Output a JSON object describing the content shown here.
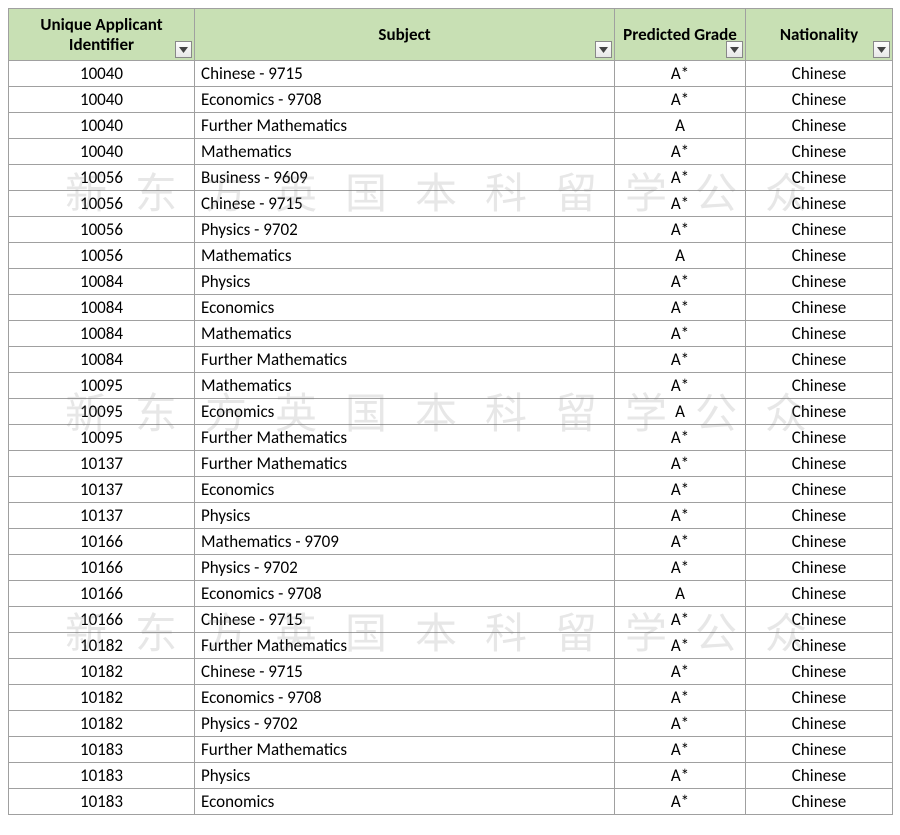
{
  "headers": {
    "id": "Unique Applicant Identifier",
    "subject": "Subject",
    "grade": "Predicted Grade",
    "nationality": "Nationality"
  },
  "watermark_text": "新东方英国本科留学公众",
  "rows": [
    {
      "id": "10040",
      "subject": "Chinese - 9715",
      "grade": "A*",
      "nationality": "Chinese"
    },
    {
      "id": "10040",
      "subject": "Economics - 9708",
      "grade": "A*",
      "nationality": "Chinese"
    },
    {
      "id": "10040",
      "subject": "Further Mathematics",
      "grade": "A",
      "nationality": "Chinese"
    },
    {
      "id": "10040",
      "subject": "Mathematics",
      "grade": "A*",
      "nationality": "Chinese"
    },
    {
      "id": "10056",
      "subject": "Business - 9609",
      "grade": "A*",
      "nationality": "Chinese"
    },
    {
      "id": "10056",
      "subject": "Chinese - 9715",
      "grade": "A*",
      "nationality": "Chinese"
    },
    {
      "id": "10056",
      "subject": "Physics - 9702",
      "grade": "A*",
      "nationality": "Chinese"
    },
    {
      "id": "10056",
      "subject": "Mathematics",
      "grade": "A",
      "nationality": "Chinese"
    },
    {
      "id": "10084",
      "subject": "Physics",
      "grade": "A*",
      "nationality": "Chinese"
    },
    {
      "id": "10084",
      "subject": "Economics",
      "grade": "A*",
      "nationality": "Chinese"
    },
    {
      "id": "10084",
      "subject": "Mathematics",
      "grade": "A*",
      "nationality": "Chinese"
    },
    {
      "id": "10084",
      "subject": "Further Mathematics",
      "grade": "A*",
      "nationality": "Chinese"
    },
    {
      "id": "10095",
      "subject": "Mathematics",
      "grade": "A*",
      "nationality": "Chinese"
    },
    {
      "id": "10095",
      "subject": "Economics",
      "grade": "A",
      "nationality": "Chinese"
    },
    {
      "id": "10095",
      "subject": "Further Mathematics",
      "grade": "A*",
      "nationality": "Chinese"
    },
    {
      "id": "10137",
      "subject": "Further Mathematics",
      "grade": "A*",
      "nationality": "Chinese"
    },
    {
      "id": "10137",
      "subject": "Economics",
      "grade": "A*",
      "nationality": "Chinese"
    },
    {
      "id": "10137",
      "subject": "Physics",
      "grade": "A*",
      "nationality": "Chinese"
    },
    {
      "id": "10166",
      "subject": "Mathematics - 9709",
      "grade": "A*",
      "nationality": "Chinese"
    },
    {
      "id": "10166",
      "subject": "Physics - 9702",
      "grade": "A*",
      "nationality": "Chinese"
    },
    {
      "id": "10166",
      "subject": "Economics - 9708",
      "grade": "A",
      "nationality": "Chinese"
    },
    {
      "id": "10166",
      "subject": "Chinese - 9715",
      "grade": "A*",
      "nationality": "Chinese"
    },
    {
      "id": "10182",
      "subject": "Further Mathematics",
      "grade": "A*",
      "nationality": "Chinese"
    },
    {
      "id": "10182",
      "subject": "Chinese - 9715",
      "grade": "A*",
      "nationality": "Chinese"
    },
    {
      "id": "10182",
      "subject": "Economics - 9708",
      "grade": "A*",
      "nationality": "Chinese"
    },
    {
      "id": "10182",
      "subject": "Physics - 9702",
      "grade": "A*",
      "nationality": "Chinese"
    },
    {
      "id": "10183",
      "subject": "Further Mathematics",
      "grade": "A*",
      "nationality": "Chinese"
    },
    {
      "id": "10183",
      "subject": "Physics",
      "grade": "A*",
      "nationality": "Chinese"
    },
    {
      "id": "10183",
      "subject": "Economics",
      "grade": "A*",
      "nationality": "Chinese"
    }
  ]
}
